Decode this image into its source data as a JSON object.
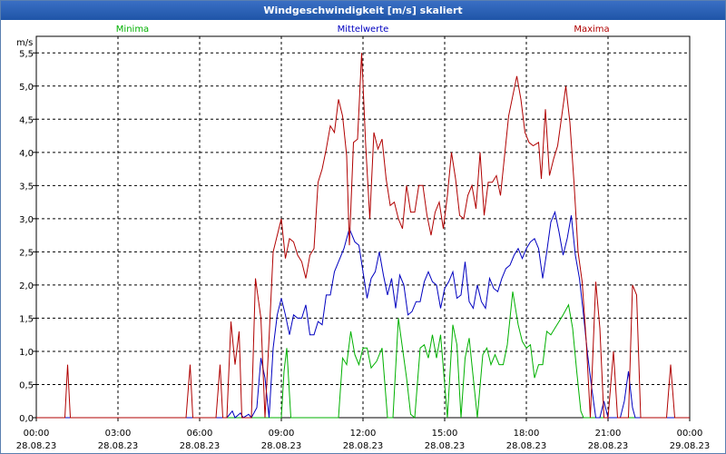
{
  "window": {
    "title": "Windgeschwindigkeit [m/s] skaliert"
  },
  "chart_data": {
    "type": "line",
    "title": "Windgeschwindigkeit [m/s] skaliert",
    "ylabel": "m/s",
    "xlabel": "",
    "ylim": [
      0,
      5.75
    ],
    "xlim": [
      "28.08.23 00:00",
      "29.08.23 00:00"
    ],
    "grid": true,
    "legend_position": "top",
    "y_ticks": [
      "0,0",
      "0,5",
      "1,0",
      "1,5",
      "2,0",
      "2,5",
      "3,0",
      "3,5",
      "4,0",
      "4,5",
      "5,0",
      "5,5"
    ],
    "x_ticks": [
      {
        "time": "00:00",
        "date": "28.08.23"
      },
      {
        "time": "03:00",
        "date": "28.08.23"
      },
      {
        "time": "06:00",
        "date": "28.08.23"
      },
      {
        "time": "09:00",
        "date": "28.08.23"
      },
      {
        "time": "12:00",
        "date": "28.08.23"
      },
      {
        "time": "15:00",
        "date": "28.08.23"
      },
      {
        "time": "18:00",
        "date": "28.08.23"
      },
      {
        "time": "21:00",
        "date": "28.08.23"
      },
      {
        "time": "00:00",
        "date": "29.08.23"
      }
    ],
    "x_unit": "hours since 28.08.23 00:00",
    "series": [
      {
        "name": "Minima",
        "color": "#00b000",
        "points": [
          [
            0,
            0
          ],
          [
            9.0,
            0
          ],
          [
            9.1,
            0.7
          ],
          [
            9.2,
            1.05
          ],
          [
            9.35,
            0
          ],
          [
            11.1,
            0
          ],
          [
            11.25,
            0.9
          ],
          [
            11.4,
            0.8
          ],
          [
            11.55,
            1.3
          ],
          [
            11.7,
            0.95
          ],
          [
            11.85,
            0.8
          ],
          [
            12.0,
            1.05
          ],
          [
            12.15,
            1.05
          ],
          [
            12.3,
            0.75
          ],
          [
            12.5,
            0.85
          ],
          [
            12.7,
            1.05
          ],
          [
            12.9,
            0.0
          ],
          [
            13.1,
            0.0
          ],
          [
            13.3,
            1.5
          ],
          [
            13.45,
            1.05
          ],
          [
            13.6,
            0.6
          ],
          [
            13.75,
            0.05
          ],
          [
            13.9,
            0.0
          ],
          [
            14.1,
            1.05
          ],
          [
            14.25,
            1.1
          ],
          [
            14.4,
            0.9
          ],
          [
            14.55,
            1.25
          ],
          [
            14.7,
            0.9
          ],
          [
            14.85,
            1.25
          ],
          [
            15.0,
            0.5
          ],
          [
            15.1,
            0.0
          ],
          [
            15.3,
            1.4
          ],
          [
            15.45,
            1.1
          ],
          [
            15.6,
            0.0
          ],
          [
            15.75,
            0.9
          ],
          [
            15.9,
            1.2
          ],
          [
            16.05,
            0.6
          ],
          [
            16.2,
            0.0
          ],
          [
            16.4,
            0.95
          ],
          [
            16.55,
            1.05
          ],
          [
            16.7,
            0.8
          ],
          [
            16.85,
            0.95
          ],
          [
            17.0,
            0.8
          ],
          [
            17.15,
            0.8
          ],
          [
            17.3,
            1.1
          ],
          [
            17.5,
            1.9
          ],
          [
            17.7,
            1.4
          ],
          [
            17.85,
            1.15
          ],
          [
            18.0,
            1.05
          ],
          [
            18.15,
            1.1
          ],
          [
            18.3,
            0.6
          ],
          [
            18.45,
            0.8
          ],
          [
            18.6,
            0.8
          ],
          [
            18.75,
            1.3
          ],
          [
            18.9,
            1.25
          ],
          [
            19.05,
            1.35
          ],
          [
            19.2,
            1.45
          ],
          [
            19.35,
            1.55
          ],
          [
            19.55,
            1.7
          ],
          [
            19.7,
            1.35
          ],
          [
            19.85,
            0.7
          ],
          [
            20.0,
            0.1
          ],
          [
            20.1,
            0.0
          ],
          [
            24,
            0
          ]
        ]
      },
      {
        "name": "Mittelwerte",
        "color": "#0000c0",
        "points": [
          [
            0,
            0
          ],
          [
            7.0,
            0
          ],
          [
            7.2,
            0.1
          ],
          [
            7.3,
            0.0
          ],
          [
            7.5,
            0.07
          ],
          [
            7.6,
            0.0
          ],
          [
            7.8,
            0.05
          ],
          [
            7.9,
            0.0
          ],
          [
            8.1,
            0.15
          ],
          [
            8.25,
            0.9
          ],
          [
            8.4,
            0.6
          ],
          [
            8.55,
            0.0
          ],
          [
            8.7,
            1.05
          ],
          [
            8.85,
            1.55
          ],
          [
            9.0,
            1.8
          ],
          [
            9.15,
            1.55
          ],
          [
            9.3,
            1.25
          ],
          [
            9.45,
            1.55
          ],
          [
            9.6,
            1.5
          ],
          [
            9.75,
            1.5
          ],
          [
            9.9,
            1.7
          ],
          [
            10.05,
            1.25
          ],
          [
            10.2,
            1.25
          ],
          [
            10.35,
            1.45
          ],
          [
            10.5,
            1.4
          ],
          [
            10.65,
            1.85
          ],
          [
            10.8,
            1.85
          ],
          [
            10.95,
            2.2
          ],
          [
            11.1,
            2.35
          ],
          [
            11.3,
            2.55
          ],
          [
            11.5,
            2.85
          ],
          [
            11.7,
            2.65
          ],
          [
            11.85,
            2.6
          ],
          [
            12.0,
            2.2
          ],
          [
            12.15,
            1.8
          ],
          [
            12.3,
            2.1
          ],
          [
            12.45,
            2.2
          ],
          [
            12.6,
            2.5
          ],
          [
            12.75,
            2.15
          ],
          [
            12.9,
            1.85
          ],
          [
            13.05,
            2.1
          ],
          [
            13.2,
            1.65
          ],
          [
            13.35,
            2.15
          ],
          [
            13.5,
            2.0
          ],
          [
            13.65,
            1.55
          ],
          [
            13.8,
            1.6
          ],
          [
            13.95,
            1.75
          ],
          [
            14.1,
            1.75
          ],
          [
            14.25,
            2.05
          ],
          [
            14.4,
            2.2
          ],
          [
            14.55,
            2.05
          ],
          [
            14.7,
            2.0
          ],
          [
            14.85,
            1.65
          ],
          [
            15.0,
            1.95
          ],
          [
            15.15,
            2.05
          ],
          [
            15.3,
            2.2
          ],
          [
            15.45,
            1.8
          ],
          [
            15.6,
            1.85
          ],
          [
            15.75,
            2.35
          ],
          [
            15.9,
            1.75
          ],
          [
            16.05,
            1.65
          ],
          [
            16.2,
            2.0
          ],
          [
            16.35,
            1.75
          ],
          [
            16.5,
            1.65
          ],
          [
            16.65,
            2.1
          ],
          [
            16.8,
            1.95
          ],
          [
            16.95,
            1.9
          ],
          [
            17.1,
            2.1
          ],
          [
            17.25,
            2.25
          ],
          [
            17.4,
            2.3
          ],
          [
            17.55,
            2.45
          ],
          [
            17.7,
            2.55
          ],
          [
            17.85,
            2.4
          ],
          [
            18.0,
            2.55
          ],
          [
            18.15,
            2.65
          ],
          [
            18.3,
            2.7
          ],
          [
            18.45,
            2.55
          ],
          [
            18.6,
            2.1
          ],
          [
            18.75,
            2.5
          ],
          [
            18.9,
            2.95
          ],
          [
            19.05,
            3.1
          ],
          [
            19.2,
            2.8
          ],
          [
            19.35,
            2.45
          ],
          [
            19.5,
            2.7
          ],
          [
            19.65,
            3.05
          ],
          [
            19.8,
            2.45
          ],
          [
            19.95,
            2.1
          ],
          [
            20.1,
            1.55
          ],
          [
            20.25,
            0.95
          ],
          [
            20.4,
            0.45
          ],
          [
            20.55,
            0.0
          ],
          [
            20.7,
            0.0
          ],
          [
            20.85,
            0.25
          ],
          [
            21.0,
            0.0
          ],
          [
            21.45,
            0.0
          ],
          [
            21.6,
            0.25
          ],
          [
            21.75,
            0.7
          ],
          [
            21.9,
            0.15
          ],
          [
            22.0,
            0.0
          ],
          [
            24,
            0
          ]
        ]
      },
      {
        "name": "Maxima",
        "color": "#b00000",
        "points": [
          [
            0,
            0
          ],
          [
            1.05,
            0
          ],
          [
            1.15,
            0.8
          ],
          [
            1.25,
            0
          ],
          [
            5.5,
            0
          ],
          [
            5.65,
            0.8
          ],
          [
            5.75,
            0
          ],
          [
            6.6,
            0
          ],
          [
            6.75,
            0.8
          ],
          [
            6.85,
            0
          ],
          [
            7.0,
            0
          ],
          [
            7.15,
            1.45
          ],
          [
            7.3,
            0.8
          ],
          [
            7.45,
            1.3
          ],
          [
            7.55,
            0
          ],
          [
            7.9,
            0
          ],
          [
            8.05,
            2.1
          ],
          [
            8.25,
            1.5
          ],
          [
            8.4,
            0.0
          ],
          [
            8.55,
            1.2
          ],
          [
            8.7,
            2.5
          ],
          [
            8.85,
            2.75
          ],
          [
            9.0,
            3.0
          ],
          [
            9.15,
            2.4
          ],
          [
            9.3,
            2.7
          ],
          [
            9.45,
            2.65
          ],
          [
            9.6,
            2.45
          ],
          [
            9.75,
            2.35
          ],
          [
            9.9,
            2.1
          ],
          [
            10.05,
            2.45
          ],
          [
            10.2,
            2.55
          ],
          [
            10.35,
            3.55
          ],
          [
            10.5,
            3.75
          ],
          [
            10.65,
            4.05
          ],
          [
            10.8,
            4.4
          ],
          [
            10.95,
            4.3
          ],
          [
            11.1,
            4.8
          ],
          [
            11.25,
            4.55
          ],
          [
            11.4,
            3.95
          ],
          [
            11.5,
            2.6
          ],
          [
            11.65,
            4.15
          ],
          [
            11.8,
            4.2
          ],
          [
            11.95,
            5.5
          ],
          [
            12.1,
            4.1
          ],
          [
            12.25,
            3.0
          ],
          [
            12.4,
            4.3
          ],
          [
            12.55,
            4.05
          ],
          [
            12.7,
            4.2
          ],
          [
            12.85,
            3.6
          ],
          [
            13.0,
            3.2
          ],
          [
            13.15,
            3.25
          ],
          [
            13.3,
            3.0
          ],
          [
            13.45,
            2.85
          ],
          [
            13.6,
            3.5
          ],
          [
            13.75,
            3.1
          ],
          [
            13.9,
            3.1
          ],
          [
            14.05,
            3.5
          ],
          [
            14.2,
            3.5
          ],
          [
            14.35,
            3.05
          ],
          [
            14.5,
            2.75
          ],
          [
            14.65,
            3.1
          ],
          [
            14.8,
            3.25
          ],
          [
            14.95,
            2.85
          ],
          [
            15.1,
            3.35
          ],
          [
            15.25,
            4.0
          ],
          [
            15.4,
            3.6
          ],
          [
            15.55,
            3.05
          ],
          [
            15.7,
            3.0
          ],
          [
            15.85,
            3.35
          ],
          [
            16.0,
            3.5
          ],
          [
            16.15,
            3.15
          ],
          [
            16.3,
            4.0
          ],
          [
            16.45,
            3.05
          ],
          [
            16.6,
            3.55
          ],
          [
            16.75,
            3.55
          ],
          [
            16.9,
            3.65
          ],
          [
            17.05,
            3.35
          ],
          [
            17.2,
            3.95
          ],
          [
            17.35,
            4.55
          ],
          [
            17.5,
            4.85
          ],
          [
            17.65,
            5.15
          ],
          [
            17.8,
            4.8
          ],
          [
            17.95,
            4.3
          ],
          [
            18.1,
            4.15
          ],
          [
            18.25,
            4.1
          ],
          [
            18.45,
            4.15
          ],
          [
            18.55,
            3.6
          ],
          [
            18.7,
            4.65
          ],
          [
            18.85,
            3.65
          ],
          [
            19.0,
            3.9
          ],
          [
            19.15,
            4.1
          ],
          [
            19.3,
            4.55
          ],
          [
            19.45,
            5.0
          ],
          [
            19.6,
            4.45
          ],
          [
            19.75,
            3.55
          ],
          [
            19.9,
            2.5
          ],
          [
            20.05,
            2.05
          ],
          [
            20.2,
            1.15
          ],
          [
            20.35,
            0.0
          ],
          [
            20.55,
            2.05
          ],
          [
            20.7,
            1.35
          ],
          [
            20.85,
            0.0
          ],
          [
            21.0,
            0.0
          ],
          [
            21.2,
            1.0
          ],
          [
            21.35,
            0.0
          ],
          [
            21.75,
            0.0
          ],
          [
            21.9,
            2.0
          ],
          [
            22.05,
            1.85
          ],
          [
            22.2,
            0.0
          ],
          [
            23.15,
            0.0
          ],
          [
            23.3,
            0.8
          ],
          [
            23.45,
            0
          ],
          [
            24,
            0
          ]
        ]
      }
    ]
  }
}
